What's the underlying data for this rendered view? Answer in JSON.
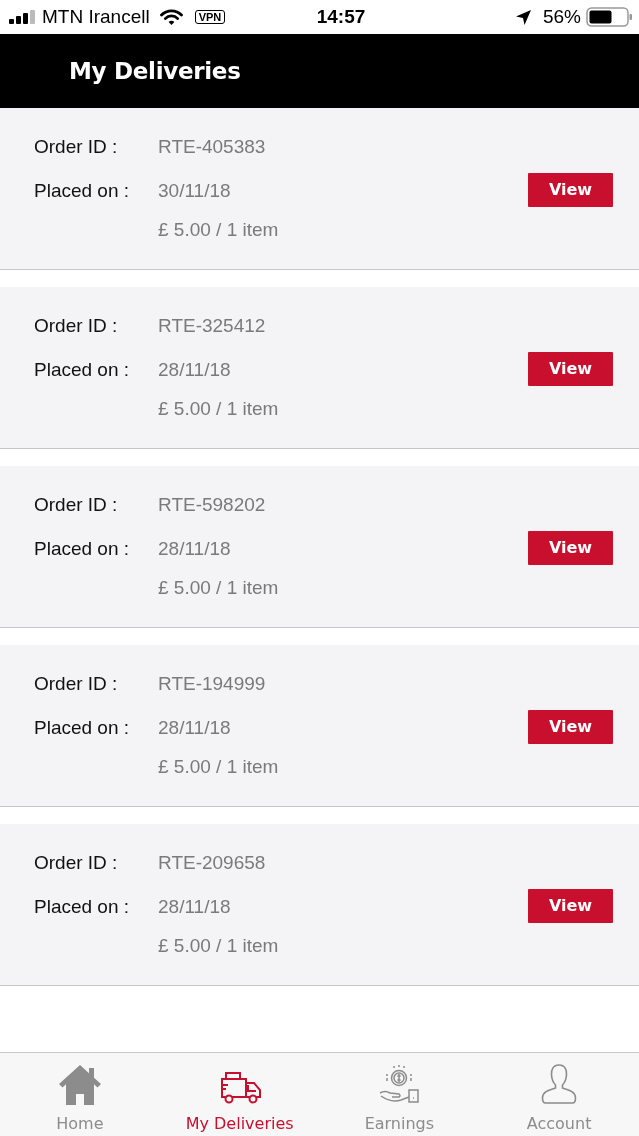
{
  "status_bar": {
    "carrier": "MTN Irancell",
    "vpn": "VPN",
    "time": "14:57",
    "battery": "56%"
  },
  "header": {
    "title": "My Deliveries"
  },
  "orders": [
    {
      "order_id_label": "Order ID :",
      "order_id": "RTE-405383",
      "placed_label": "Placed on :",
      "placed_on": "30/11/18",
      "summary": "£ 5.00 / 1 item",
      "button": "View"
    },
    {
      "order_id_label": "Order ID :",
      "order_id": "RTE-325412",
      "placed_label": "Placed on :",
      "placed_on": "28/11/18",
      "summary": "£ 5.00 / 1 item",
      "button": "View"
    },
    {
      "order_id_label": "Order ID :",
      "order_id": "RTE-598202",
      "placed_label": "Placed on :",
      "placed_on": "28/11/18",
      "summary": "£ 5.00 / 1 item",
      "button": "View"
    },
    {
      "order_id_label": "Order ID :",
      "order_id": "RTE-194999",
      "placed_label": "Placed on :",
      "placed_on": "28/11/18",
      "summary": "£ 5.00 / 1 item",
      "button": "View"
    },
    {
      "order_id_label": "Order ID :",
      "order_id": "RTE-209658",
      "placed_label": "Placed on :",
      "placed_on": "28/11/18",
      "summary": "£ 5.00 / 1 item",
      "button": "View"
    }
  ],
  "tab_bar": [
    {
      "kind": "home",
      "label": "Home",
      "selected": false
    },
    {
      "kind": "deliveries",
      "label": "My Deliveries",
      "selected": true
    },
    {
      "kind": "earnings",
      "label": "Earnings",
      "selected": false
    },
    {
      "kind": "account",
      "label": "Account",
      "selected": false
    }
  ]
}
